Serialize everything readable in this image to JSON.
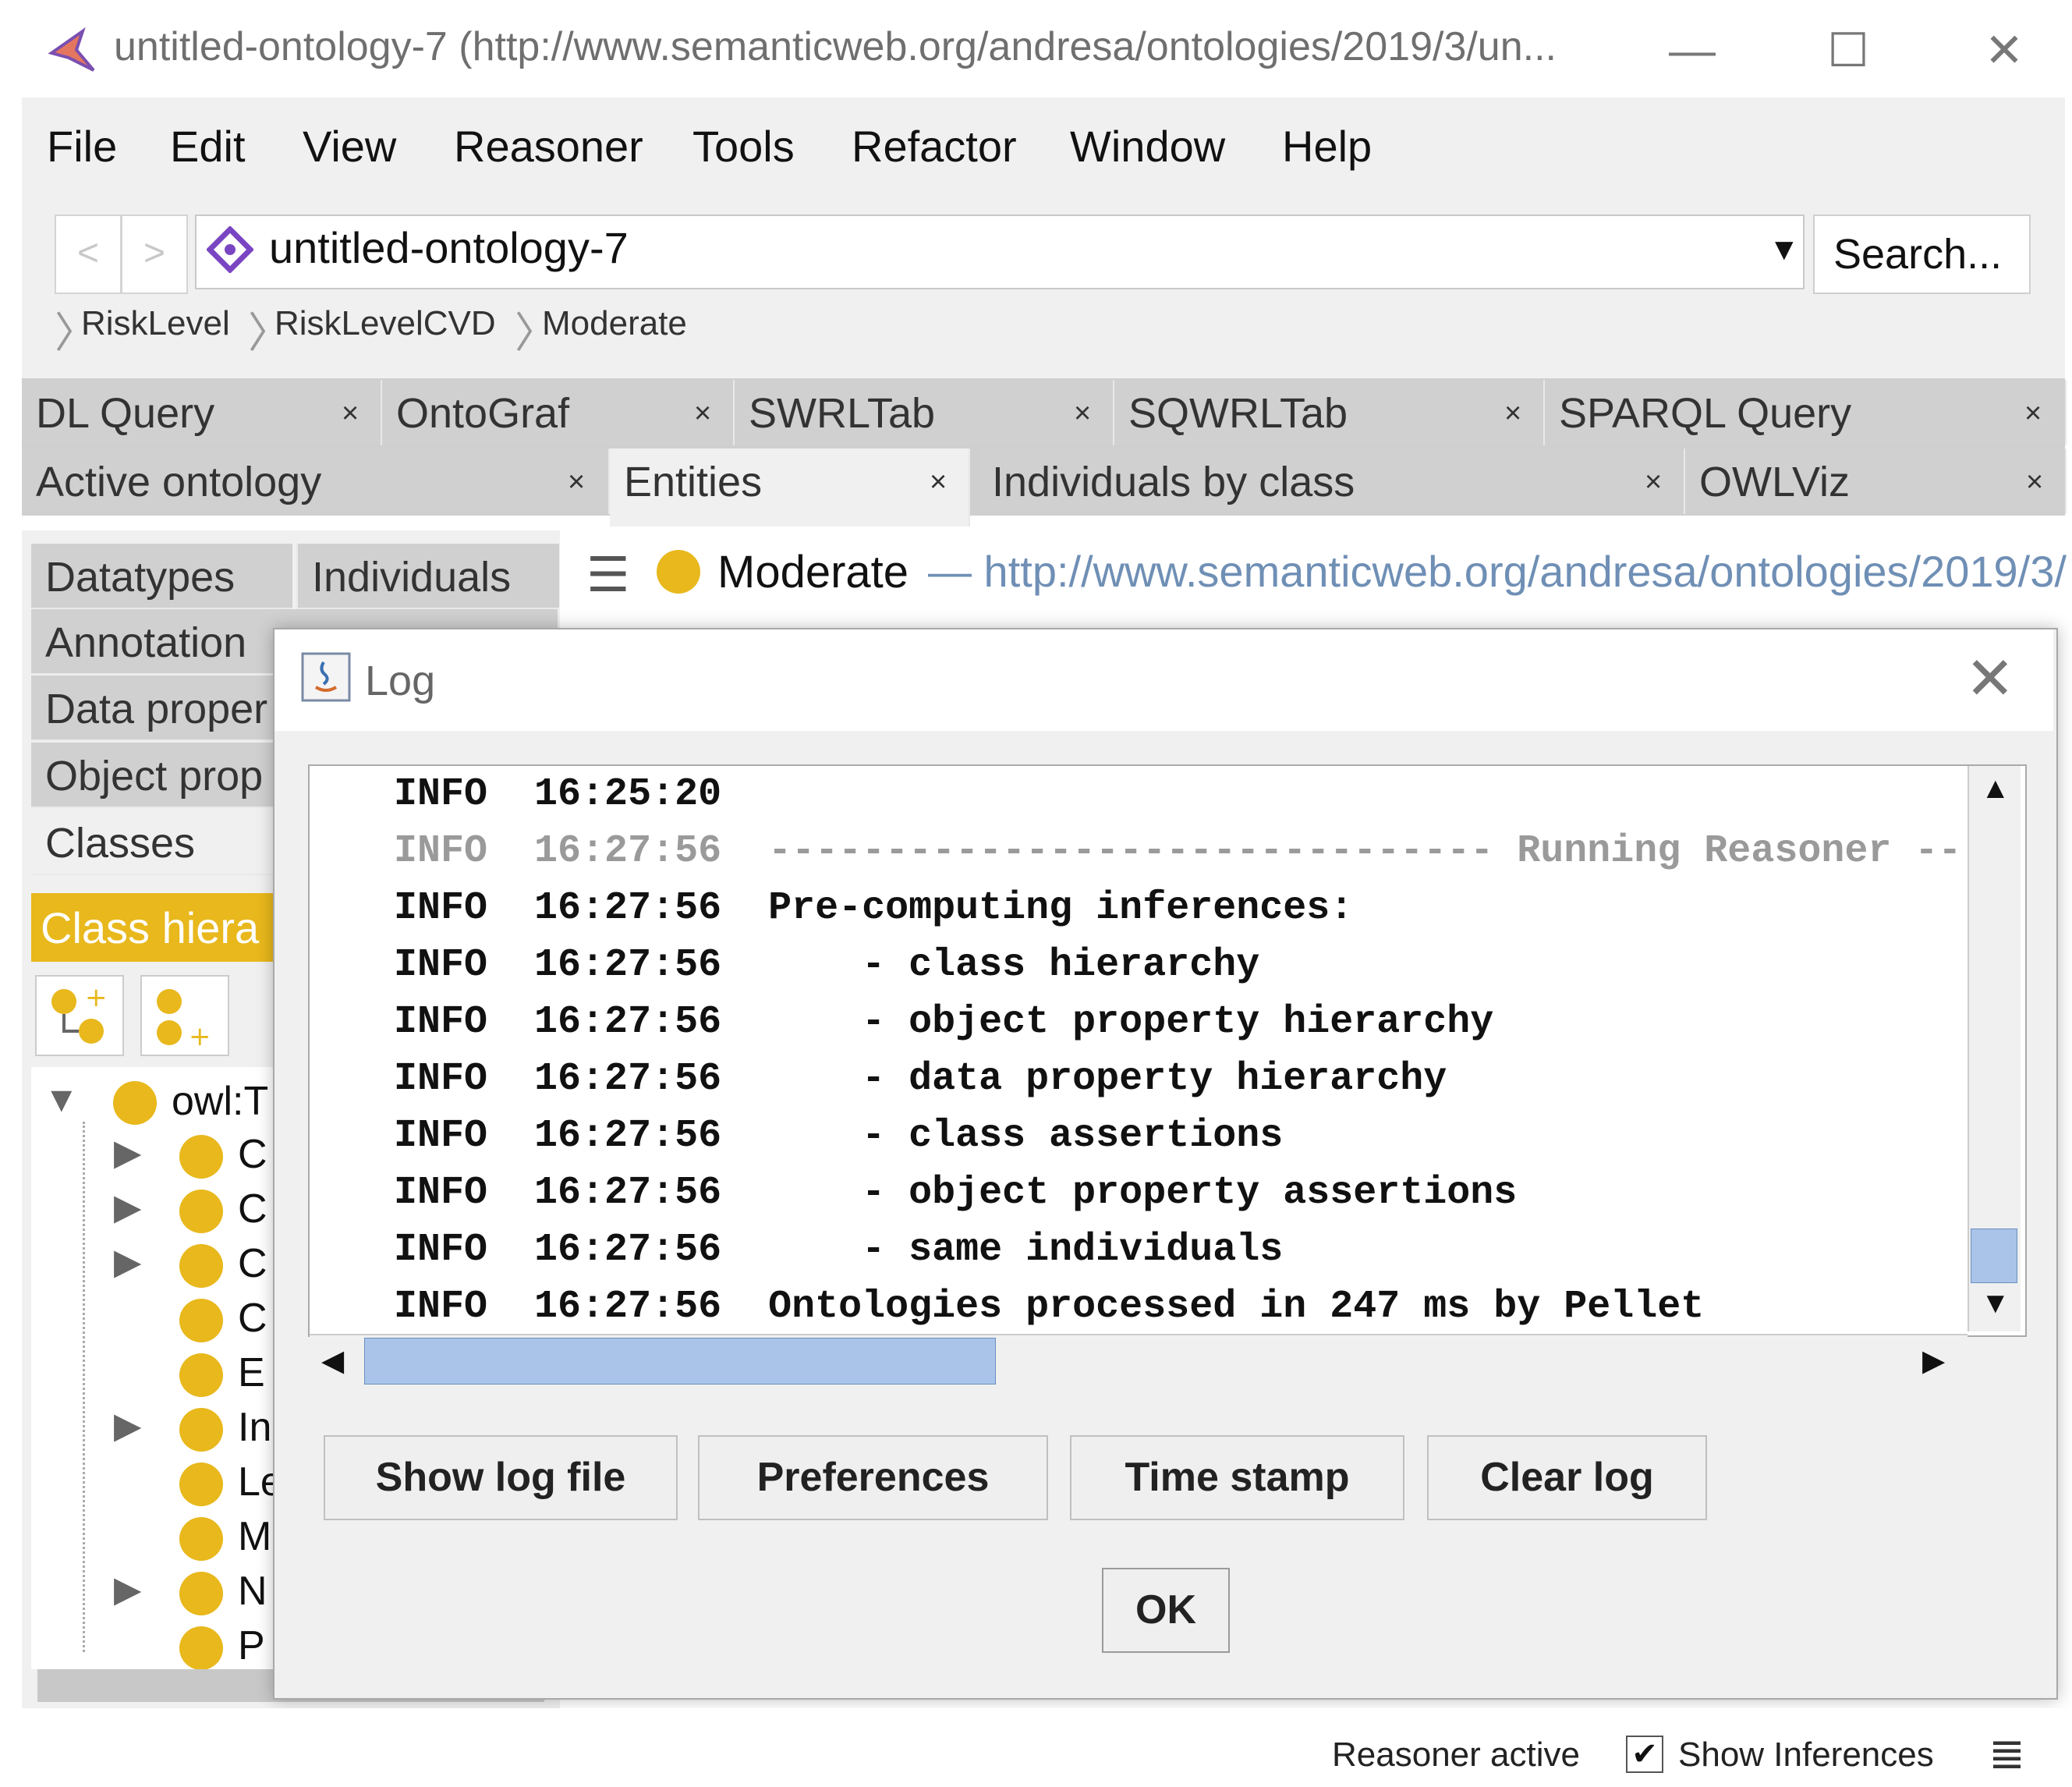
{
  "window": {
    "title": "untitled-ontology-7 (http://www.semanticweb.org/andresa/ontologies/2019/3/un...",
    "minimize": "—",
    "maximize": "☐",
    "close": "✕"
  },
  "menu": [
    "File",
    "Edit",
    "View",
    "Reasoner",
    "Tools",
    "Refactor",
    "Window",
    "Help"
  ],
  "toolbar": {
    "back": "<",
    "forward": ">",
    "ontology": "untitled-ontology-7",
    "search": "Search..."
  },
  "breadcrumb": [
    "RiskLevel",
    "RiskLevelCVD",
    "Moderate"
  ],
  "tabs_row1": [
    "DL Query",
    "OntoGraf",
    "SWRLTab",
    "SQWRLTab",
    "SPARQL Query"
  ],
  "tabs_row2": [
    "Active ontology",
    "Entities",
    "Individuals by class",
    "OWLViz"
  ],
  "tab_close": "×",
  "left_tabs": {
    "datatypes": "Datatypes",
    "individuals": "Individuals",
    "annotation": "Annotation",
    "data_properties": "Data proper",
    "object_properties": "Object prop",
    "classes": "Classes",
    "class_hierarchy": "Class hiera"
  },
  "tree": {
    "root": "owl:T",
    "items": [
      "C",
      "C",
      "C",
      "C",
      "E",
      "In",
      "Le",
      "M",
      "N",
      "P"
    ]
  },
  "entity": {
    "name": "Moderate",
    "iri": "— http://www.semanticweb.org/andresa/ontologies/2019/3/"
  },
  "dialog": {
    "title": "Log",
    "log": [
      {
        "level": "INFO",
        "time": "16:25:20",
        "msg": ""
      },
      {
        "level": "INFO",
        "time": "16:27:56",
        "msg": "------------------------------- Running Reasoner --"
      },
      {
        "level": "INFO",
        "time": "16:27:56",
        "msg": "Pre-computing inferences:"
      },
      {
        "level": "INFO",
        "time": "16:27:56",
        "msg": "    - class hierarchy"
      },
      {
        "level": "INFO",
        "time": "16:27:56",
        "msg": "    - object property hierarchy"
      },
      {
        "level": "INFO",
        "time": "16:27:56",
        "msg": "    - data property hierarchy"
      },
      {
        "level": "INFO",
        "time": "16:27:56",
        "msg": "    - class assertions"
      },
      {
        "level": "INFO",
        "time": "16:27:56",
        "msg": "    - object property assertions"
      },
      {
        "level": "INFO",
        "time": "16:27:56",
        "msg": "    - same individuals"
      },
      {
        "level": "INFO",
        "time": "16:27:56",
        "msg": "Ontologies processed in 247 ms by Pellet"
      }
    ],
    "buttons": {
      "show_log": "Show log file",
      "preferences": "Preferences",
      "time_stamp": "Time stamp",
      "clear_log": "Clear log",
      "ok": "OK"
    }
  },
  "status": {
    "reasoner": "Reasoner active",
    "checkmark": "✔",
    "show_inferences": "Show Inferences"
  }
}
